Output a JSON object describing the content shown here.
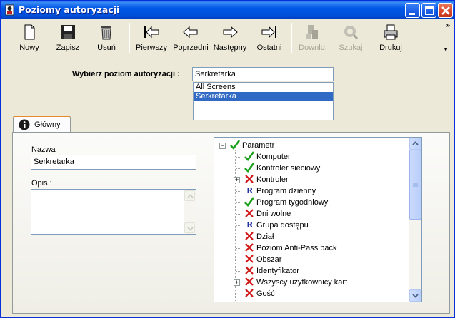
{
  "window": {
    "title": "Poziomy autoryzacji"
  },
  "toolbar": {
    "items": [
      {
        "label": "Nowy",
        "icon": "new-document-icon",
        "enabled": true
      },
      {
        "label": "Zapisz",
        "icon": "save-disk-icon",
        "enabled": true
      },
      {
        "label": "Usuń",
        "icon": "trash-bin-icon",
        "enabled": true
      },
      {
        "label": "Pierwszy",
        "icon": "first-arrow-icon",
        "enabled": true
      },
      {
        "label": "Poprzedni",
        "icon": "previous-arrow-icon",
        "enabled": true
      },
      {
        "label": "Następny",
        "icon": "next-arrow-icon",
        "enabled": true
      },
      {
        "label": "Ostatni",
        "icon": "last-arrow-icon",
        "enabled": true
      },
      {
        "label": "Downld.",
        "icon": "download-icon",
        "enabled": false
      },
      {
        "label": "Szukaj",
        "icon": "search-icon",
        "enabled": false
      },
      {
        "label": "Drukuj",
        "icon": "printer-icon",
        "enabled": true
      }
    ],
    "overflow": "»"
  },
  "selector": {
    "label": "Wybierz poziom autoryzacji :",
    "value": "Serkretarka",
    "options": [
      "All Screens",
      "Serkretarka"
    ],
    "selected_index": 1
  },
  "tab": {
    "label": "Główny"
  },
  "form": {
    "name_label": "Nazwa",
    "name_value": "Serkretarka",
    "desc_label": "Opis :",
    "desc_value": ""
  },
  "tree": {
    "root": {
      "label": "Parametr",
      "state": "allowed",
      "expanded": true
    },
    "items": [
      {
        "label": "Komputer",
        "state": "allowed",
        "expandable": false
      },
      {
        "label": "Kontroler sieciowy",
        "state": "allowed",
        "expandable": false
      },
      {
        "label": "Kontroler",
        "state": "denied",
        "expandable": true
      },
      {
        "label": "Program dzienny",
        "state": "read",
        "expandable": false
      },
      {
        "label": "Program tygodniowy",
        "state": "allowed",
        "expandable": false
      },
      {
        "label": "Dni wolne",
        "state": "denied",
        "expandable": false
      },
      {
        "label": "Grupa dostępu",
        "state": "read",
        "expandable": false
      },
      {
        "label": "Dział",
        "state": "denied",
        "expandable": false
      },
      {
        "label": "Poziom Anti-Pass back",
        "state": "denied",
        "expandable": false
      },
      {
        "label": "Obszar",
        "state": "denied",
        "expandable": false
      },
      {
        "label": "Identyfikator",
        "state": "denied",
        "expandable": false
      },
      {
        "label": "Wszyscy użytkownicy kart",
        "state": "denied",
        "expandable": true
      },
      {
        "label": "Gość",
        "state": "denied",
        "expandable": false
      }
    ],
    "read_letter": "R",
    "colors": {
      "allowed": "#1aa01a",
      "denied": "#d01818",
      "read": "#2030a0"
    }
  }
}
